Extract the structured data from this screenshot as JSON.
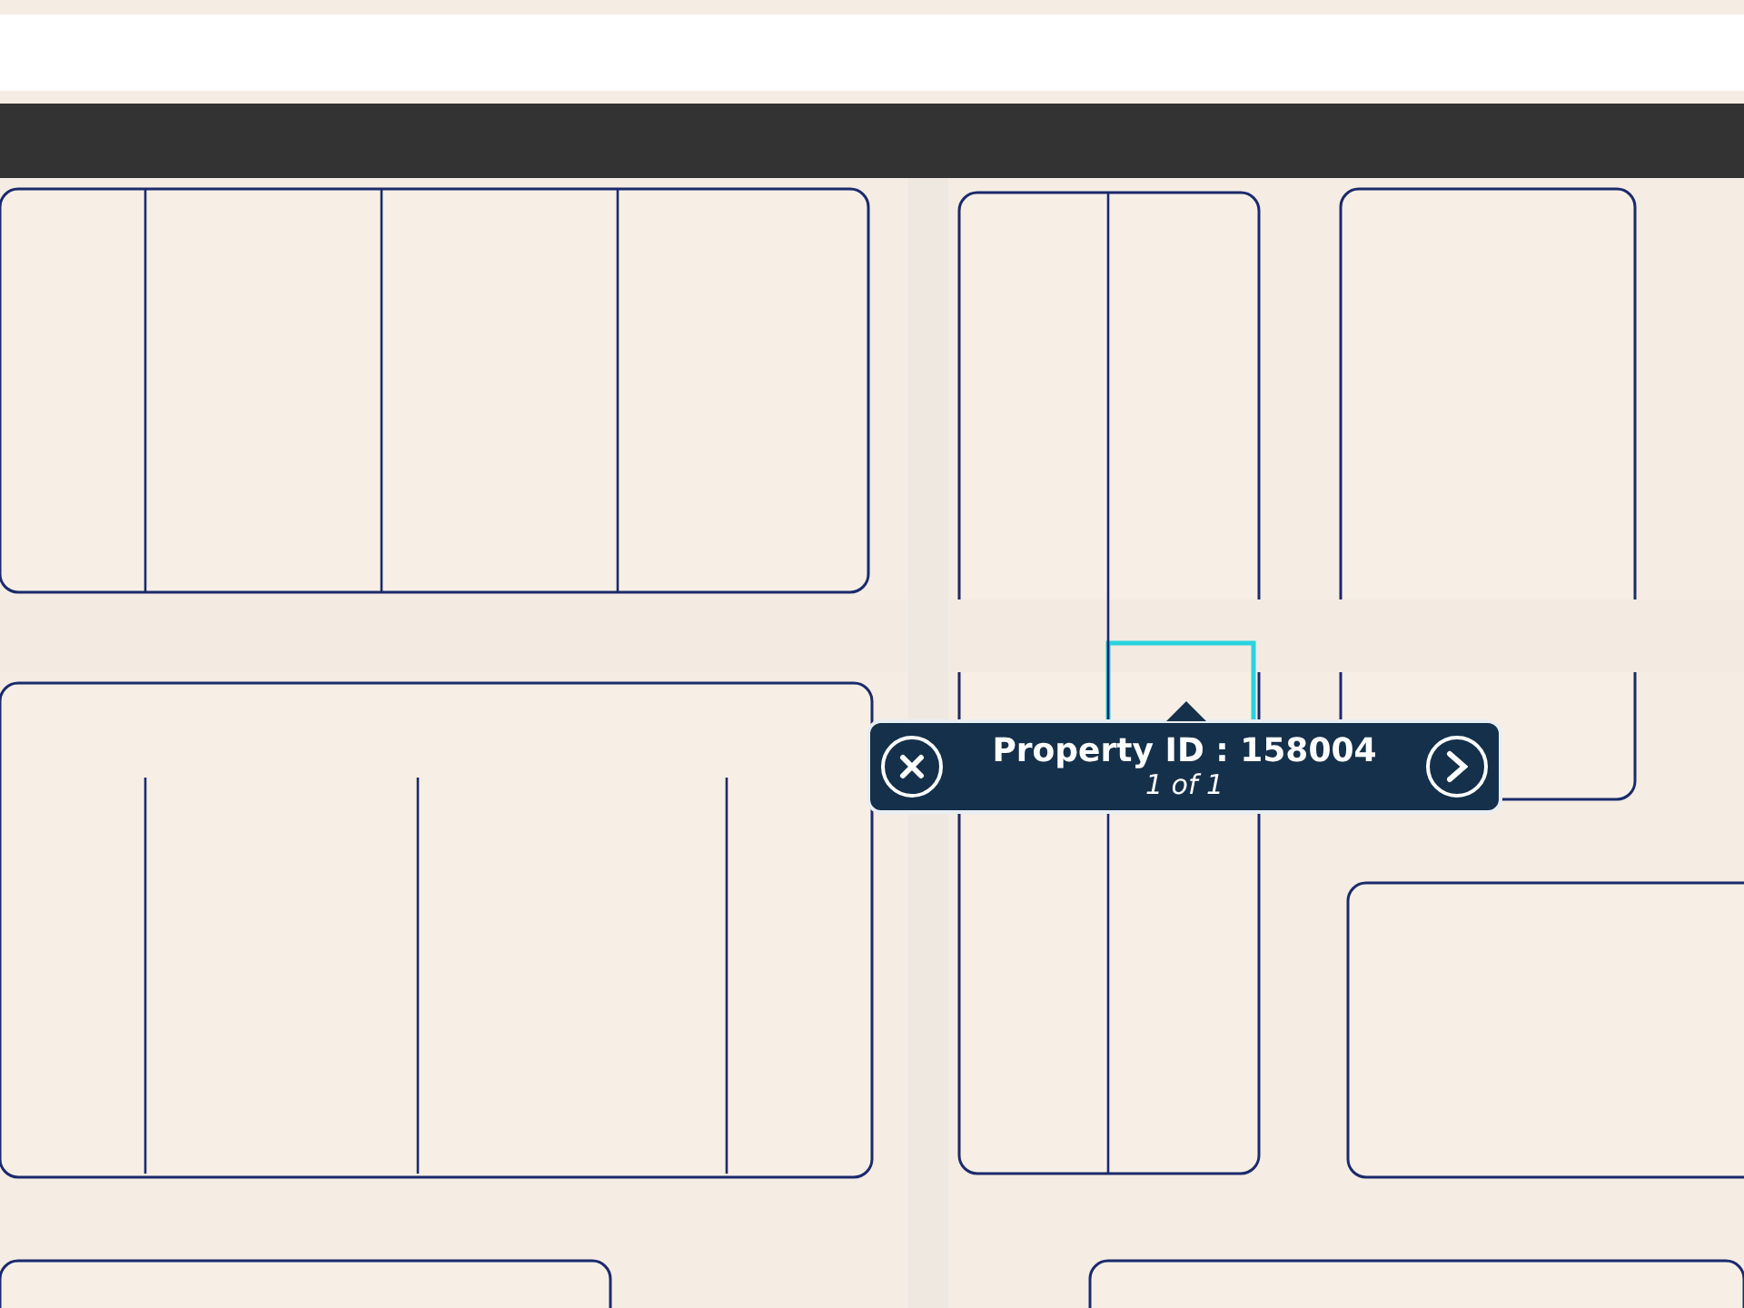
{
  "popup": {
    "title": "Property ID : 158004",
    "subtitle": "1 of 1"
  }
}
